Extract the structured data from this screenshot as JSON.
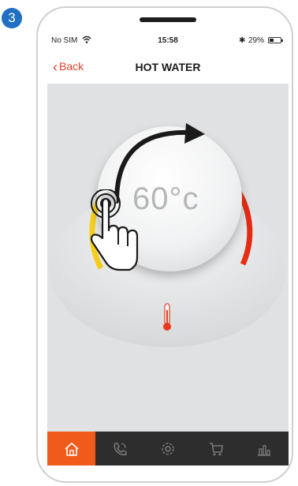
{
  "step_number": "3",
  "status_bar": {
    "carrier": "No SIM",
    "time": "15:58",
    "battery_percent": "29%",
    "battery_level": 0.29
  },
  "nav": {
    "back_label": "Back",
    "title": "HOT WATER"
  },
  "dial": {
    "temperature": "60°c",
    "gradient_colors": [
      "#f7d11a",
      "#f29a18",
      "#ec5a1a",
      "#e52a14"
    ],
    "arrow_color": "#1a1a1a"
  },
  "tab_bar": {
    "tabs": [
      {
        "icon": "home-icon",
        "active": true
      },
      {
        "icon": "phone-icon",
        "active": false
      },
      {
        "icon": "gear-icon",
        "active": false
      },
      {
        "icon": "cart-icon",
        "active": false
      },
      {
        "icon": "chart-icon",
        "active": false
      }
    ],
    "active_color": "#f05a1a",
    "icon_color": "#7a7a7a"
  }
}
